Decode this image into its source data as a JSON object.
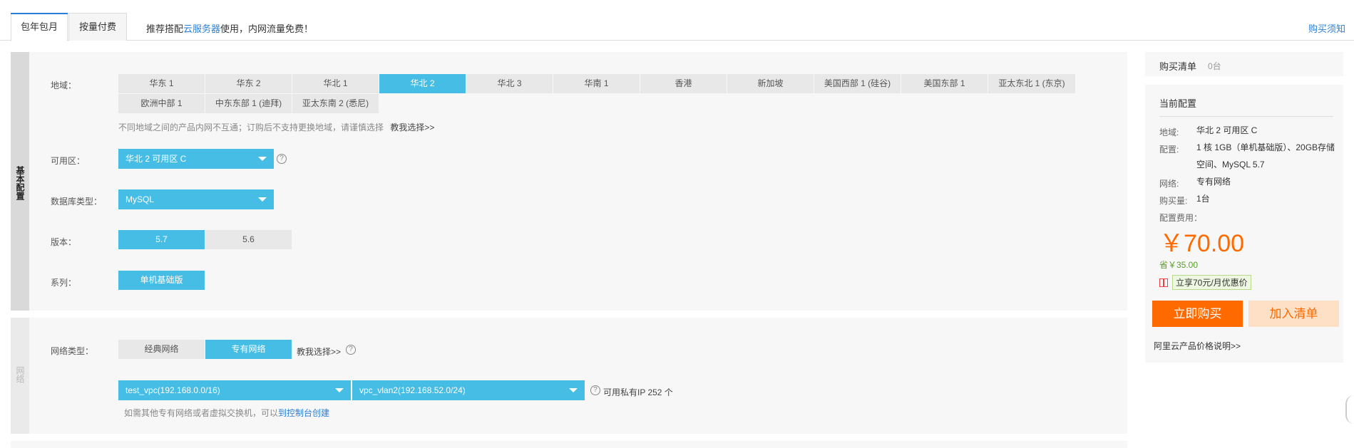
{
  "tabs": [
    {
      "label": "包年包月",
      "active": true
    },
    {
      "label": "按量付费",
      "active": false
    }
  ],
  "notice": {
    "before": "推荐搭配",
    "link": "云服务器",
    "after": "使用，内网流量免费！"
  },
  "buy_notice": "购买须知",
  "basic": {
    "section_label": "基本配置",
    "region": {
      "label": "地域：",
      "options": [
        "华东 1",
        "华东 2",
        "华北 1",
        "华北 2",
        "华北 3",
        "华南 1",
        "香港",
        "新加坡",
        "美国西部 1 (硅谷)",
        "美国东部 1",
        "亚太东北 1 (东京)",
        "欧洲中部 1",
        "中东东部 1 (迪拜)",
        "亚太东南 2 (悉尼)"
      ],
      "selected": "华北 2",
      "hint": "不同地域之间的产品内网不互通；订购后不支持更换地域，请谨慎选择",
      "hint_link": "教我选择>>"
    },
    "zone": {
      "label": "可用区：",
      "value": "华北 2 可用区 C",
      "help": "?"
    },
    "db_type": {
      "label": "数据库类型：",
      "value": "MySQL"
    },
    "version": {
      "label": "版本：",
      "options": [
        "5.7",
        "5.6"
      ],
      "selected": "5.7"
    },
    "series": {
      "label": "系列：",
      "options": [
        "单机基础版"
      ],
      "selected": "单机基础版"
    }
  },
  "network": {
    "section_label": "网络",
    "type": {
      "label": "网络类型：",
      "options": [
        "经典网络",
        "专有网络"
      ],
      "selected": "专有网络",
      "help_link": "教我选择>>"
    },
    "vpc": "test_vpc(192.168.0.0/16)",
    "vswitch": "vpc_vlan2(192.168.52.0/24)",
    "available_ip": "可用私有IP 252 个",
    "hint_before": "如需其他专有网络或者虚拟交换机，可以",
    "hint_link": "到控制台创建"
  },
  "cart": {
    "title": "购买清单",
    "count": "0台"
  },
  "current": {
    "title": "当前配置",
    "region_k": "地域:",
    "region_v": "华北 2 可用区 C",
    "config_k": "配置:",
    "config_v": "1 核 1GB（单机基础版）、20GB存储空间、MySQL 5.7",
    "network_k": "网络:",
    "network_v": "专有网络",
    "qty_k": "购买量:",
    "qty_v": "1台",
    "fee_label": "配置费用：",
    "price": "￥70.00",
    "save": "省￥35.00",
    "promo": "立享70元/月优惠价",
    "buy_button": "立即购买",
    "add_button": "加入清单",
    "price_note": "阿里云产品价格说明>>"
  },
  "colors": {
    "accent": "#45bde4",
    "orange": "#ff6a00",
    "link": "#2a7fd4"
  }
}
